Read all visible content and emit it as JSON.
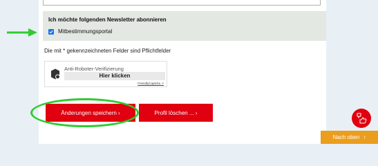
{
  "newsletter": {
    "heading": "Ich möchte folgenden Newsletter abonnieren",
    "option_label": "Mitbestimmungsportal",
    "option_checked": true
  },
  "required_note": "Die mit * gekennzeichneten Felder sind Pflichtfelder",
  "captcha": {
    "title": "Anti-Roboter-Verifizierung",
    "button_label": "Hier klicken",
    "link_text": "FriendlyCaptcha ↗"
  },
  "actions": {
    "save_label": "Änderungen speichern ›",
    "delete_label": "Profil löschen ... ›"
  },
  "floating": {
    "back_to_top_label": "Nach oben",
    "back_to_top_icon": "↑",
    "feedback_icon": "thumbs-feedback-icon"
  },
  "colors": {
    "primary_red": "#e0000f",
    "accent_orange": "#eb9d1e",
    "annotation_green": "#2ecc2e",
    "newsletter_bg": "#e3e8e2",
    "checkbox_blue": "#1a73e8"
  }
}
